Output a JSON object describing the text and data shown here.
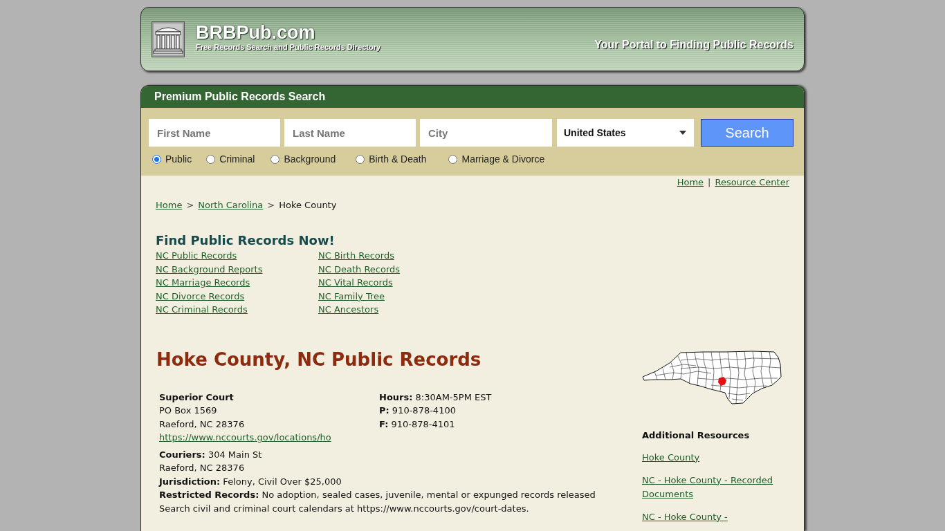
{
  "header": {
    "site_name": "BRBPub.com",
    "tagline": "Free Records Search and Public Records Directory",
    "slogan": "Your Portal to Finding Public Records"
  },
  "search_panel": {
    "title": "Premium Public Records Search",
    "fields": [
      {
        "placeholder": "First Name"
      },
      {
        "placeholder": "Last Name"
      },
      {
        "placeholder": "City"
      }
    ],
    "country_select": {
      "value": "United States"
    },
    "search_button": "Search",
    "record_types": [
      {
        "label": "Public",
        "selected": true
      },
      {
        "label": "Criminal",
        "selected": false
      },
      {
        "label": "Background",
        "selected": false
      },
      {
        "label": "Birth & Death",
        "selected": false
      },
      {
        "label": "Marriage & Divorce",
        "selected": false
      }
    ]
  },
  "top_links": {
    "separator": "|",
    "links": [
      "Home",
      "Resource Center"
    ]
  },
  "breadcrumb": {
    "separator": ">",
    "items": [
      {
        "label": "Home",
        "kind": "link"
      },
      {
        "label": "North Carolina",
        "kind": "link"
      },
      {
        "label": "Hoke County",
        "kind": "current"
      }
    ]
  },
  "find_records": {
    "heading": "Find Public Records Now!",
    "columns": [
      [
        "NC Public Records",
        "NC Background Reports",
        "NC Marriage Records",
        "NC Divorce Records",
        "NC Criminal Records"
      ],
      [
        "NC Birth Records",
        "NC Death Records",
        "NC Vital Records",
        "NC Family Tree",
        "NC Ancestors"
      ]
    ]
  },
  "page_title": "Hoke County, NC Public Records",
  "court": {
    "name": "Superior Court",
    "address_lines": [
      "PO Box 1569",
      "Raeford, NC 28376"
    ],
    "url": "https://www.nccourts.gov/locations/ho",
    "contact_lines": [
      "**Hours:** 8:30AM-5PM EST",
      "**P:** 910-878-4100",
      "**F:** 910-878-4101"
    ],
    "detail_lines": [
      "**Couriers:** 304 Main St",
      "Raeford, NC 28376",
      "**Jurisdiction:** Felony, Civil Over $25,000",
      "**Restricted Records:** No adoption, sealed cases, juvenile, mental or expunged records released",
      "Search civil and criminal court calendars at https://www.nccourts.gov/court-dates."
    ]
  },
  "sidebar": {
    "heading": "Additional Resources",
    "links": [
      "Hoke County",
      "NC - Hoke County - Recorded Documents",
      "NC - Hoke County -"
    ]
  }
}
